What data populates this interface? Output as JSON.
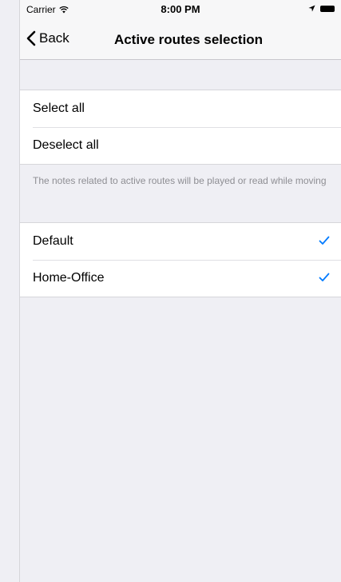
{
  "status_bar": {
    "carrier": "Carrier",
    "time": "8:00 PM"
  },
  "nav": {
    "back_label": "Back",
    "title": "Active routes selection"
  },
  "actions": {
    "select_all": "Select all",
    "deselect_all": "Deselect all"
  },
  "note": "The notes related to active routes will be played or read while moving",
  "routes": [
    {
      "label": "Default",
      "checked": true
    },
    {
      "label": "Home-Office",
      "checked": true
    }
  ],
  "colors": {
    "accent": "#007aff",
    "background": "#efeff4"
  }
}
